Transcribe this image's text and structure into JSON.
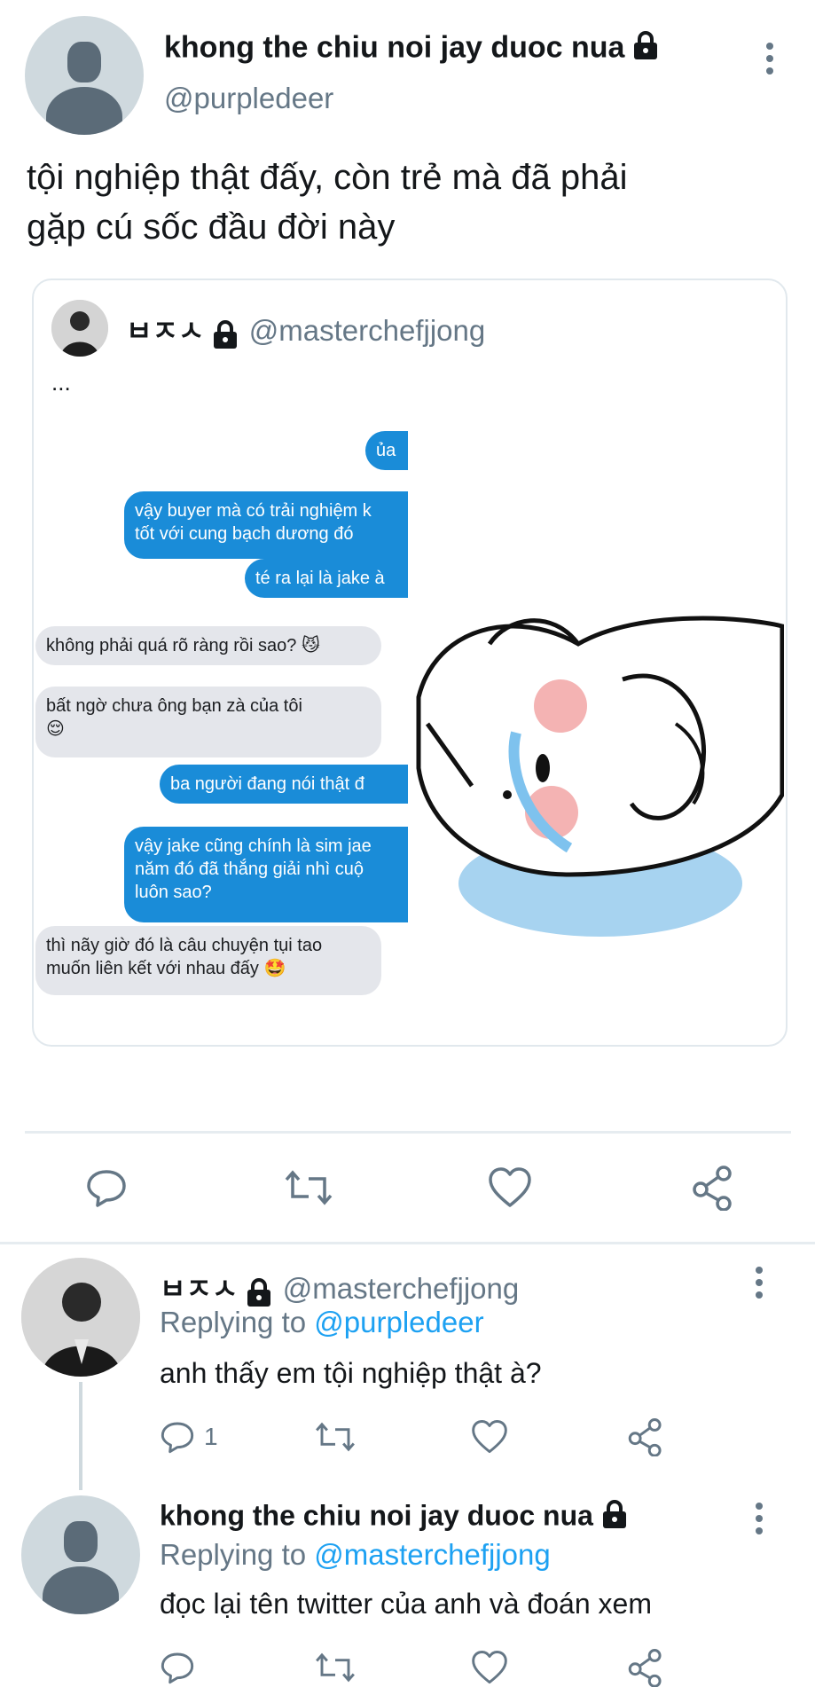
{
  "tweet": {
    "author_name": "khong the chiu noi jay duoc nua",
    "author_handle": "@purpledeer",
    "text_line1": "tội nghiệp thật đấy, còn trẻ mà đã phải",
    "text_line2": "gặp cú sốc đầu đời này"
  },
  "quote": {
    "author_name": "ㅂㅈㅅ",
    "author_handle": "@masterchefjjong",
    "ellipsis": "...",
    "chat": [
      {
        "side": "right",
        "text": "ủa"
      },
      {
        "side": "right",
        "text": "vậy buyer mà có trải nghiệm k\ntốt với cung bạch dương đó"
      },
      {
        "side": "right",
        "text": "té ra lại là jake à"
      },
      {
        "side": "left",
        "text": "không phải quá rõ ràng rồi sao? 😼"
      },
      {
        "side": "left",
        "text": "bất ngờ chưa ông bạn zà của tôi\n😌"
      },
      {
        "side": "right",
        "text": "ba người đang nói thật đ"
      },
      {
        "side": "right",
        "text": "vậy jake cũng chính là sim jae\nnăm đó đã thắng giải nhì cuộ\nluôn sao?"
      },
      {
        "side": "left",
        "text": "thì nãy giờ đó là câu chuyện tụi tao\nmuốn liên kết với nhau đấy 🤩"
      }
    ]
  },
  "replies": [
    {
      "author_name": "ㅂㅈㅅ",
      "author_handle": "@masterchefjjong",
      "replying_prefix": "Replying to",
      "replying_to": "@purpledeer",
      "text": "anh thấy em tội nghiệp thật à?",
      "reply_count": "1"
    },
    {
      "author_name": "khong the chiu noi jay duoc nua",
      "replying_prefix": "Replying to",
      "replying_to": "@masterchefjjong",
      "text": "đọc lại tên twitter của anh và đoán xem"
    }
  ],
  "colors": {
    "accent": "#1da1f2",
    "muted": "#657786",
    "bubble_blue": "#1a8cd8",
    "bubble_gray": "#e4e6eb"
  },
  "icons": [
    "reply-icon",
    "retweet-icon",
    "like-icon",
    "share-icon",
    "lock-icon",
    "more-icon"
  ]
}
